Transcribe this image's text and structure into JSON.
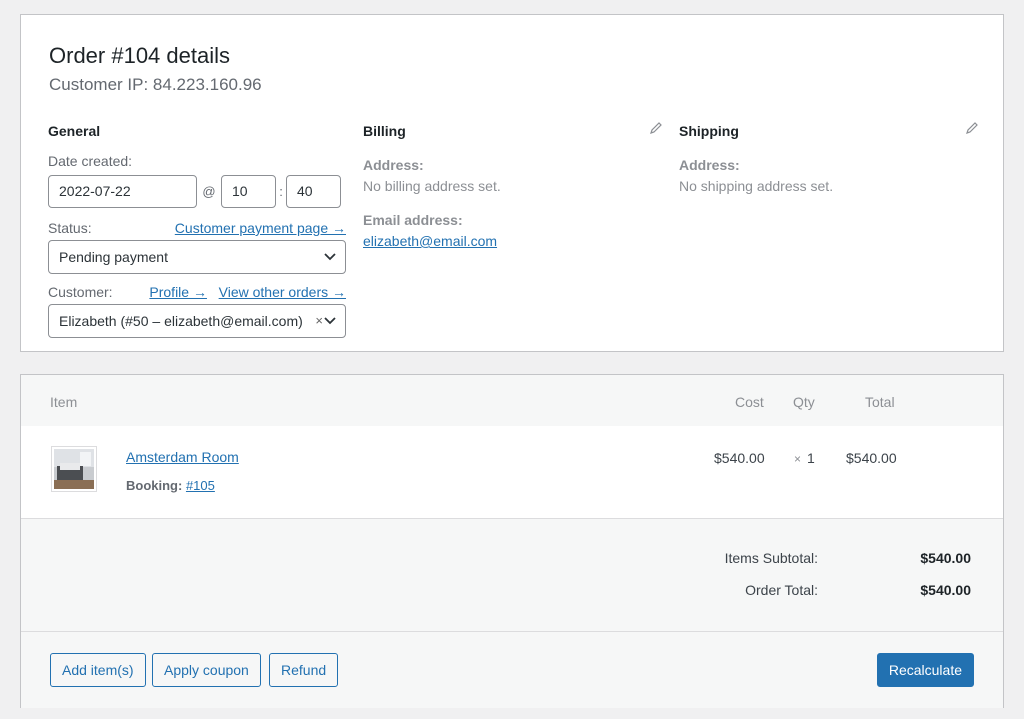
{
  "order": {
    "title": "Order #104 details",
    "customer_ip": "Customer IP: 84.223.160.96"
  },
  "general": {
    "heading": "General",
    "date_label": "Date created:",
    "date_value": "2022-07-22",
    "at_symbol": "@",
    "hour_value": "10",
    "time_separator": ":",
    "minute_value": "40",
    "status_label": "Status:",
    "customer_payment_link": "Customer payment page →",
    "status_value": "Pending payment",
    "customer_label": "Customer:",
    "profile_link": "Profile →",
    "view_orders_link": "View other orders →",
    "customer_value": "Elizabeth (#50 – elizabeth@email.com)",
    "clear_symbol": "×"
  },
  "billing": {
    "heading": "Billing",
    "address_label": "Address:",
    "address_value": "No billing address set.",
    "email_label": "Email address:",
    "email_value": "elizabeth@email.com"
  },
  "shipping": {
    "heading": "Shipping",
    "address_label": "Address:",
    "address_value": "No shipping address set."
  },
  "items": {
    "columns": {
      "item": "Item",
      "cost": "Cost",
      "qty": "Qty",
      "total": "Total"
    },
    "rows": [
      {
        "name": "Amsterdam Room",
        "meta_label": "Booking:",
        "meta_value": "#105",
        "cost": "$540.00",
        "qty_symbol": "×",
        "qty": "1",
        "total": "$540.00"
      }
    ],
    "subtotal_label": "Items Subtotal:",
    "subtotal_value": "$540.00",
    "order_total_label": "Order Total:",
    "order_total_value": "$540.00"
  },
  "actions": {
    "add_items": "Add item(s)",
    "apply_coupon": "Apply coupon",
    "refund": "Refund",
    "recalculate": "Recalculate"
  },
  "icons": {
    "edit": "pencil-icon",
    "dropdown": "chevron-down-icon",
    "thumbnail": "room-photo-thumbnail"
  },
  "colors": {
    "link": "#2271b1",
    "primary_button": "#2271b1",
    "background": "#f0f0f1",
    "border": "#c3c4c7"
  }
}
